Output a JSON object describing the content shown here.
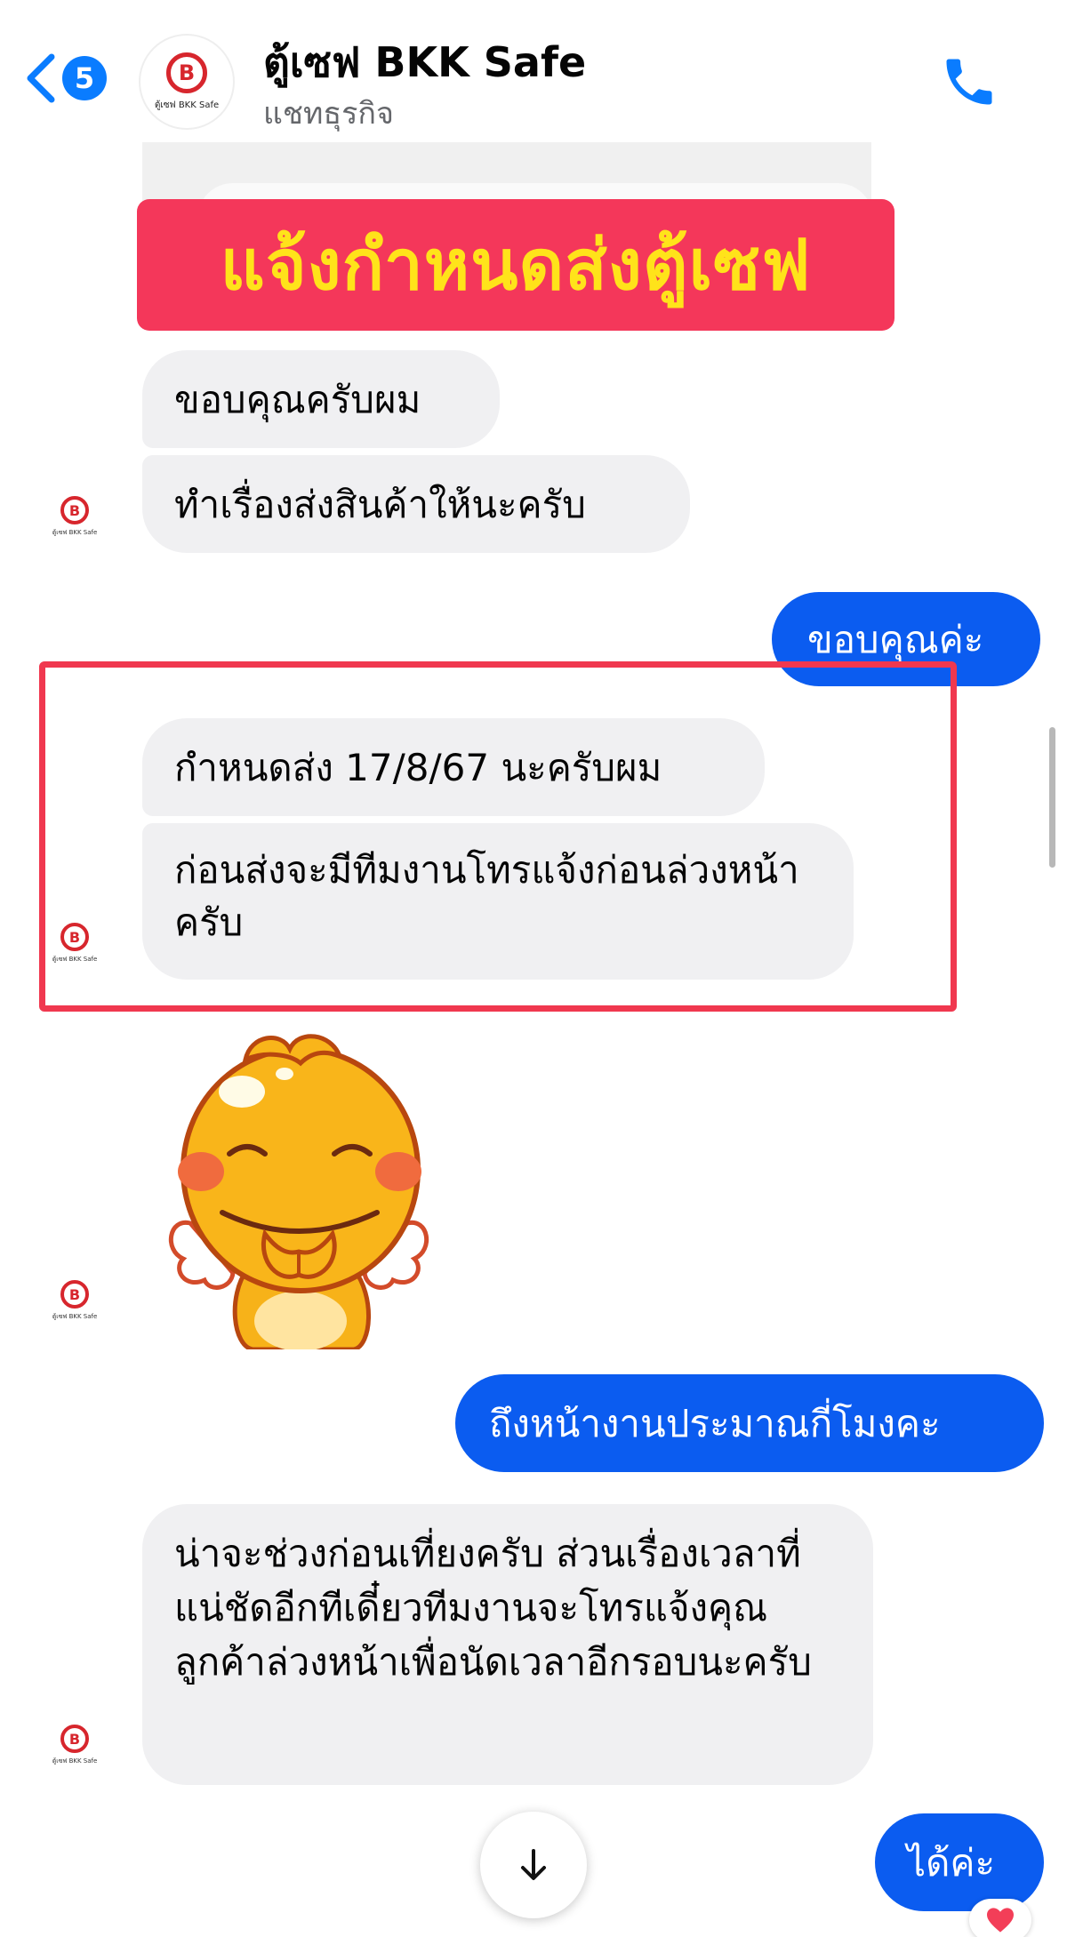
{
  "header": {
    "back_badge": "5",
    "title": "ตู้เซฟ BKK Safe",
    "subtitle": "แชทธุรกิจ",
    "avatar_logo_letter": "B",
    "avatar_logo_text": "ตู้เซฟ BKK Safe"
  },
  "banner": {
    "text": "แจ้งกำหนดส่งตู้เซฟ",
    "bg_color": "#f4375a",
    "text_color": "#ffe31a"
  },
  "messages": [
    {
      "from": "business",
      "text": "ขอบคุณครับผม"
    },
    {
      "from": "business",
      "text": "ทำเรื่องส่งสินค้าให้นะครับ"
    },
    {
      "from": "me",
      "text": "ขอบคุณค่ะ"
    },
    {
      "from": "business",
      "text": "กำหนดส่ง 17/8/67 นะครับผม"
    },
    {
      "from": "business",
      "text": "ก่อนส่งจะมีทีมงานโทรแจ้งก่อนล่วงหน้าครับ"
    },
    {
      "from": "business",
      "type": "sticker",
      "sticker": "angel-chick-sticker"
    },
    {
      "from": "me",
      "text": "ถึงหน้างานประมาณกี่โมงคะ"
    },
    {
      "from": "business",
      "text": "น่าจะช่วงก่อนเที่ยงครับ  ส่วนเรื่องเวลาที่แน่ชัดอีกทีเดี๋ยวทีมงานจะโทรแจ้งคุณลูกค้าล่วงหน้าเพื่อนัดเวลาอีกรอบนะครับ"
    },
    {
      "from": "me",
      "text": "ได้ค่ะ",
      "reaction": "heart"
    }
  ],
  "colors": {
    "outgoing_bubble": "#0b5cf0",
    "incoming_bubble": "#f0f0f2",
    "highlight_border": "#f0384f",
    "accent": "#0a7cff"
  },
  "icons": {
    "back": "chevron-left-icon",
    "call": "phone-icon",
    "scroll": "arrow-down-icon",
    "reaction": "heart-icon"
  }
}
